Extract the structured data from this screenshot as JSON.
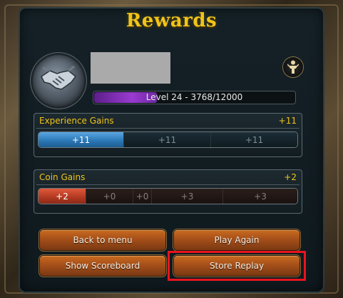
{
  "window": {
    "title": "Rewards"
  },
  "player": {
    "emblem_icon": "handshake-icon",
    "rank_icon": "champion-icon",
    "level_text": "Level 24 - 3768/12000",
    "level_progress": 0.314
  },
  "experience": {
    "label": "Experience Gains",
    "total": "+11",
    "segments": [
      "+11",
      "+11",
      "+11"
    ],
    "color": "#2c79b8"
  },
  "coins": {
    "label": "Coin Gains",
    "total": "+2",
    "segments": [
      "+2",
      "+0",
      "+0",
      "+3",
      "+3"
    ],
    "color": "#b43a22"
  },
  "buttons": {
    "back_to_menu": "Back to menu",
    "play_again": "Play Again",
    "show_scoreboard": "Show Scoreboard",
    "store_replay": "Store Replay"
  },
  "colors": {
    "accent": "#f0c419",
    "highlight": "#e8141e",
    "button": "#a5501a"
  }
}
